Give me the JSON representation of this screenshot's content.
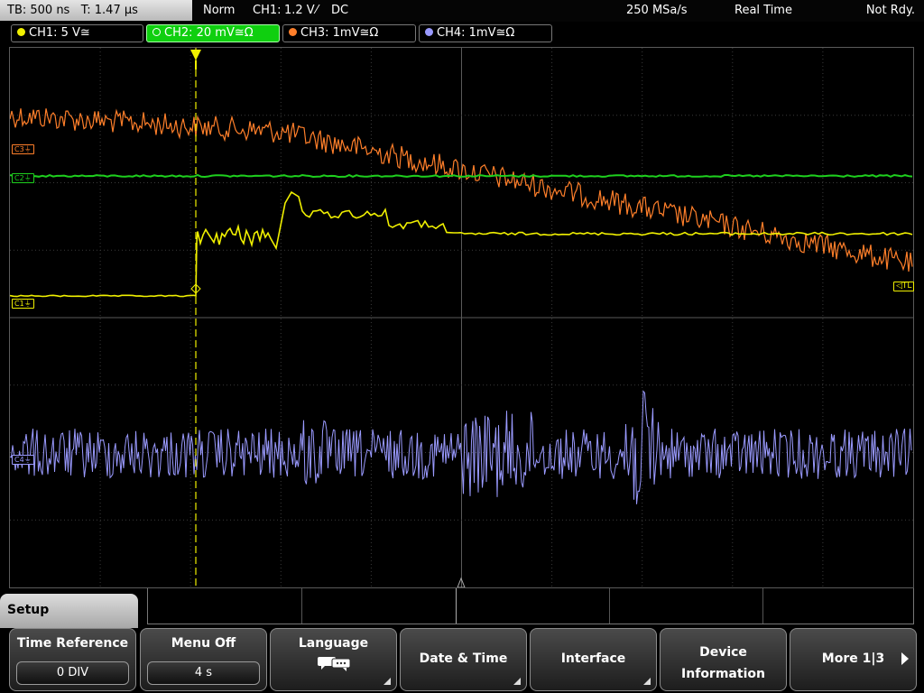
{
  "top_bar": {
    "timebase": "TB: 500 ns",
    "trigger_time": "T: 1.47 µs",
    "mode": "Norm",
    "trigger_source": "CH1:",
    "trigger_level": "1.2 V",
    "trigger_slope_icon": "rising-edge",
    "trigger_slope_glyph": "⁄",
    "trigger_coupling": "DC",
    "sample_rate": "250 MSa/s",
    "acquisition": "Real Time",
    "state": "Not Rdy."
  },
  "channels": [
    {
      "label": "CH1: 5 V≅",
      "color": "#f0f000"
    },
    {
      "label": "CH2: 20 mV≅Ω",
      "color": "#1ed01e"
    },
    {
      "label": "CH3: 1mV≅Ω",
      "color": "#ff7f2a"
    },
    {
      "label": "CH4: 1mV≅Ω",
      "color": "#9a9aff"
    }
  ],
  "markers": {
    "c3": "C3",
    "c2": "C2",
    "c1": "C1",
    "c4": "C4",
    "trigger_level": "TL"
  },
  "menu": {
    "title": "Setup",
    "softkeys": [
      {
        "label": "Time Reference",
        "value": "0 DIV"
      },
      {
        "label": "Menu Off",
        "value": "4 s"
      },
      {
        "label": "Language",
        "icon": "speech-bubbles-icon"
      },
      {
        "label": "Date & Time"
      },
      {
        "label": "Interface"
      },
      {
        "label": "Device",
        "label2": "Information"
      },
      {
        "label": "More 1|3"
      }
    ]
  },
  "colors": {
    "ch1": "#f0f000",
    "ch2": "#1ed01e",
    "ch3": "#ff7f2a",
    "ch4": "#9a9aff",
    "grid": "#4a4a4a",
    "active_tab": "#0fcf0f"
  }
}
